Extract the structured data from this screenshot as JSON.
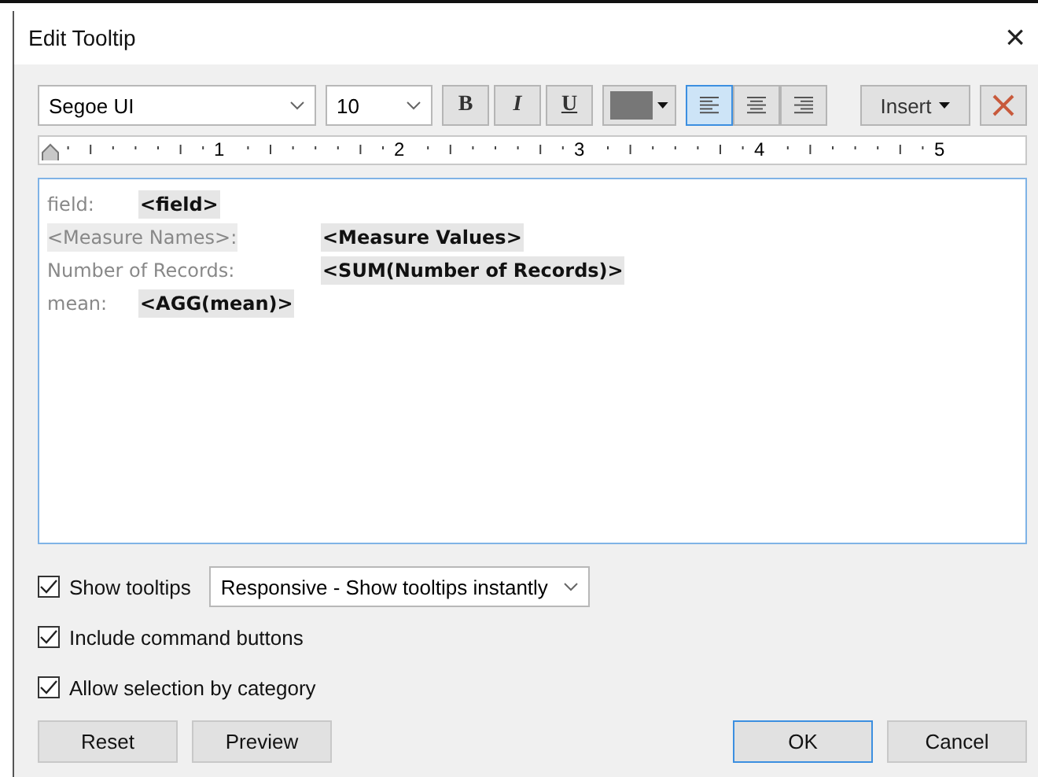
{
  "window": {
    "title": "Edit Tooltip",
    "close": "×"
  },
  "toolbar": {
    "font": "Segoe UI",
    "size": "10",
    "bold": "B",
    "italic": "I",
    "underline": "U",
    "color": "#777777",
    "align": [
      {
        "kind": "left",
        "selected": true
      },
      {
        "kind": "center",
        "selected": false
      },
      {
        "kind": "right",
        "selected": false
      }
    ],
    "insert": "Insert"
  },
  "ruler": {
    "numbers": [
      "1",
      "2",
      "3",
      "4",
      "5"
    ]
  },
  "editor": {
    "lines": [
      {
        "label": "field:",
        "label_highlighted": false,
        "value": "<field>"
      },
      {
        "label": "<Measure Names>:",
        "label_highlighted": true,
        "value": "<Measure Values>"
      },
      {
        "label": "Number of Records:",
        "label_highlighted": false,
        "value": "<SUM(Number of Records)>"
      },
      {
        "label": "mean:",
        "label_highlighted": false,
        "value": "<AGG(mean)>"
      }
    ]
  },
  "options": [
    {
      "label": "Show tooltips",
      "checked": true,
      "dropdown": "Responsive - Show tooltips instantly"
    },
    {
      "label": "Include command buttons",
      "checked": true
    },
    {
      "label": "Allow selection by category",
      "checked": true
    }
  ],
  "buttons": [
    {
      "label": "Reset",
      "kind": "left",
      "default": false
    },
    {
      "label": "Preview",
      "kind": "left",
      "default": false
    },
    {
      "label": "OK",
      "kind": "right",
      "default": true
    },
    {
      "label": "Cancel",
      "kind": "right",
      "default": false
    }
  ]
}
